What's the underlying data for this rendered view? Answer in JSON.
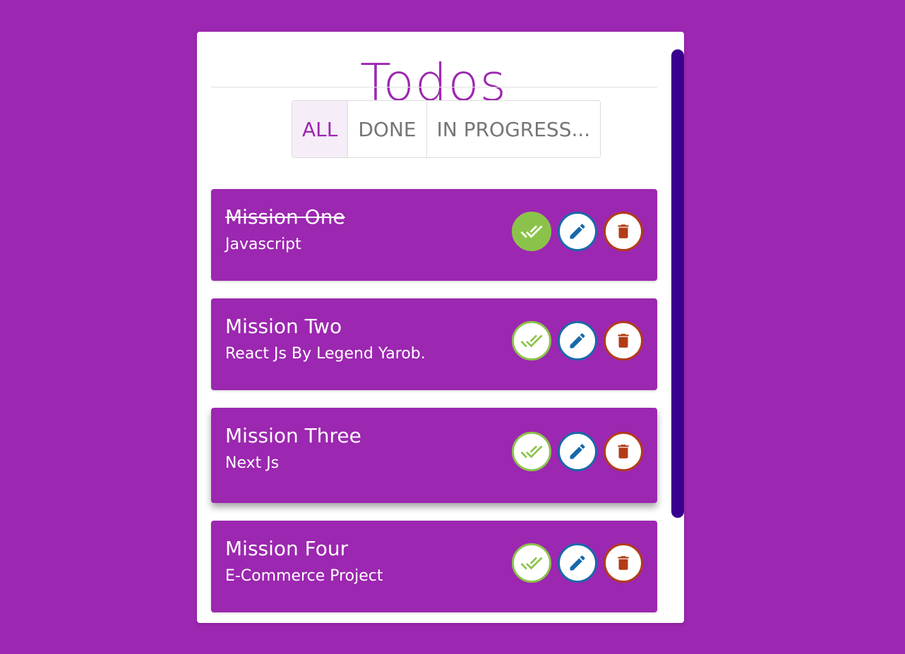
{
  "header": {
    "title": "Todos"
  },
  "filters": [
    {
      "label": "ALL",
      "selected": true
    },
    {
      "label": "DONE",
      "selected": false
    },
    {
      "label": "IN PROGRESS...",
      "selected": false
    }
  ],
  "todos": [
    {
      "title": "Mission One",
      "description": "Javascript",
      "done": true
    },
    {
      "title": "Mission Two",
      "description": "React Js By Legend Yarob.",
      "done": false
    },
    {
      "title": "Mission Three",
      "description": "Next Js",
      "done": false
    },
    {
      "title": "Mission Four",
      "description": "E-Commerce Project",
      "done": false
    }
  ],
  "icons": {
    "check": "done-all-icon",
    "edit": "pencil-icon",
    "delete": "trash-icon"
  },
  "colors": {
    "background": "#9c27b0",
    "accent": "#9c27b0",
    "check": "#8bc34a",
    "edit": "#1769aa",
    "delete": "#b23c17",
    "scrollbar": "#39008f"
  }
}
